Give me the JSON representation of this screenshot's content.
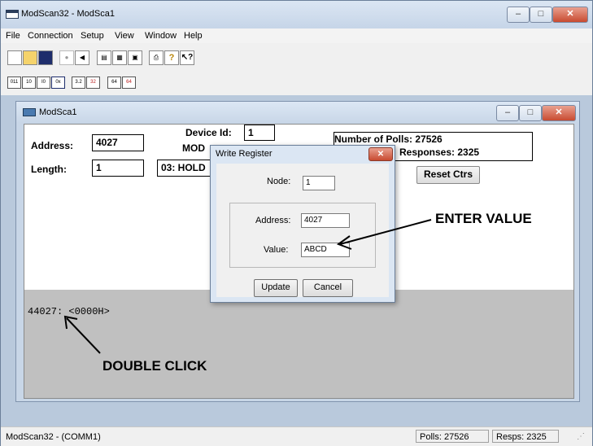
{
  "window": {
    "title": "ModScan32 - ModSca1",
    "minimize": "–",
    "maximize": "□",
    "close": "✕"
  },
  "menu": [
    "File",
    "Connection",
    "Setup",
    "View",
    "Window",
    "Help"
  ],
  "child": {
    "title": "ModSca1",
    "address_label": "Address:",
    "address_value": "4027",
    "device_id_label": "Device Id:",
    "device_id_value": "1",
    "mod_label": "MOD",
    "length_label": "Length:",
    "length_value": "1",
    "point_type": "03: HOLD",
    "polls_text": "Number of Polls: 27526",
    "responses_text": "Responses: 2325",
    "reset_button": "Reset Ctrs",
    "data_line": "44027: <0000H>"
  },
  "dialog": {
    "title": "Write Register",
    "node_label": "Node:",
    "node_value": "1",
    "address_label": "Address:",
    "address_value": "4027",
    "value_label": "Value:",
    "value_value": "ABCD",
    "update_button": "Update",
    "cancel_button": "Cancel"
  },
  "annotations": {
    "enter_value": "ENTER VALUE",
    "double_click": "DOUBLE CLICK"
  },
  "status": {
    "left": "ModScan32 - (COMM1)",
    "polls": "Polls: 27526",
    "resps": "Resps: 2325"
  }
}
